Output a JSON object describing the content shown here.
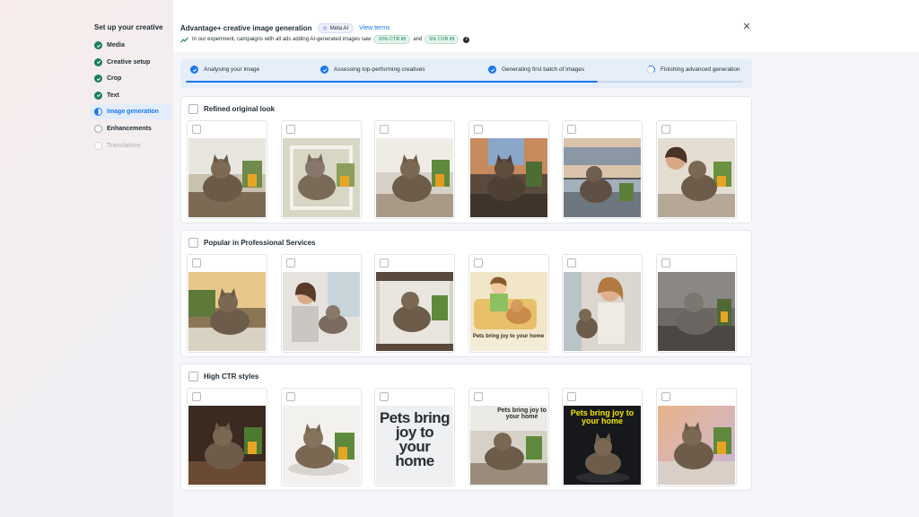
{
  "sidebar": {
    "title": "Set up your creative",
    "steps": [
      {
        "label": "Media",
        "state": "done"
      },
      {
        "label": "Creative setup",
        "state": "done"
      },
      {
        "label": "Crop",
        "state": "done"
      },
      {
        "label": "Text",
        "state": "done"
      },
      {
        "label": "Image generation",
        "state": "active"
      },
      {
        "label": "Enhancements",
        "state": "pending"
      },
      {
        "label": "Translation",
        "state": "disabled"
      }
    ]
  },
  "header": {
    "title": "Advantage+ creative image generation",
    "badge": "Meta AI",
    "view_terms": "View terms",
    "subtitle": "In our experiment, campaigns with all ads adding AI-generated images saw",
    "ctr_pill": "10% CTR lift",
    "and": "and",
    "cvr_pill": "6% CVR lift",
    "close_icon": "close-icon"
  },
  "progress": {
    "steps": [
      {
        "label": "Analysing your image",
        "state": "done"
      },
      {
        "label": "Assessing top-performing creatives",
        "state": "done"
      },
      {
        "label": "Generating first batch of images",
        "state": "done"
      },
      {
        "label": "Finishing advanced generation",
        "state": "loading"
      }
    ],
    "fill_fraction": 0.74
  },
  "sections": [
    {
      "title": "Refined original look"
    },
    {
      "title": "Popular in Professional Services"
    },
    {
      "title": "High CTR styles"
    }
  ],
  "overlays": {
    "popular_4": "Pets bring joy to your home",
    "ctr_3": "Pets bring joy to your home",
    "ctr_4": "Pets bring joy to your home",
    "ctr_5": "Pets bring joy to your home"
  },
  "colors": {
    "accent": "#1877f2",
    "success": "#19805a"
  }
}
